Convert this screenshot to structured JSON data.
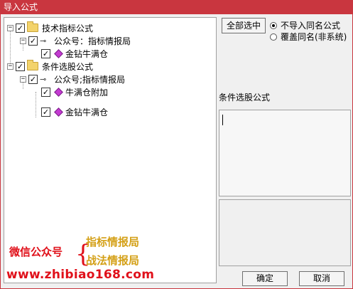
{
  "window": {
    "title": "导入公式"
  },
  "tree": {
    "groups": [
      {
        "label": "技术指标公式",
        "source": "公众号：指标情报局",
        "items": [
          "金钻牛满仓"
        ]
      },
      {
        "label": "条件选股公式",
        "source": "公众号;指标情报局",
        "items": [
          "牛满仓附加",
          "金钻牛满仓"
        ]
      }
    ],
    "expander_symbol": "−",
    "check_symbol": "✓"
  },
  "right": {
    "select_all_label": "全部选中",
    "options": [
      {
        "label": "不导入同名公式",
        "selected": true
      },
      {
        "label": "覆盖同名(非系统)",
        "selected": false
      }
    ],
    "section_label": "条件选股公式"
  },
  "ad": {
    "wechat": "微信公众号",
    "brace": "{",
    "name1": "指标情报局",
    "name2": "战法情报局",
    "url": "www.zhibiao168.com"
  },
  "buttons": {
    "ok": "确定",
    "cancel": "取消"
  },
  "colors": {
    "titlebar": "#c9363f",
    "ad_red": "#e0101a",
    "ad_gold": "#d4a017",
    "gem": "#c33bd1"
  }
}
